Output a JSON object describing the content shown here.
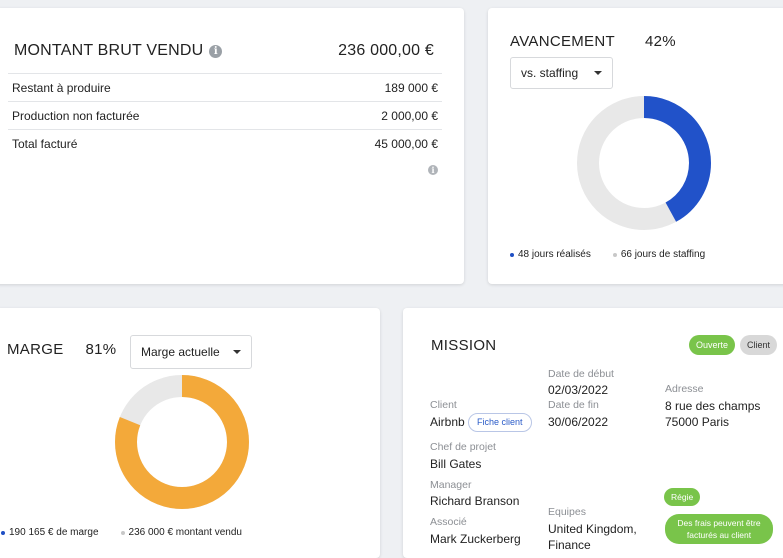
{
  "montant": {
    "title": "MONTANT BRUT VENDU",
    "total": "236 000,00 €",
    "rows": [
      {
        "label": "Restant à produire",
        "value": "189 000 €"
      },
      {
        "label": "Production non facturée",
        "value": "2 000,00 €"
      },
      {
        "label": "Total facturé",
        "value": "45 000,00 €"
      }
    ]
  },
  "avancement": {
    "title": "AVANCEMENT",
    "percent": "42%",
    "select_value": "vs. staffing",
    "legend": [
      {
        "label": "48 jours réalisés",
        "color": "#1f4fc4"
      },
      {
        "label": "66 jours de staffing",
        "color": "#c8c8c8"
      }
    ],
    "progress": 0.42,
    "colors": {
      "fill": "#2152c9",
      "track": "#e8e8e8"
    }
  },
  "marge": {
    "title": "MARGE",
    "percent": "81%",
    "select_value": "Marge actuelle",
    "legend": [
      {
        "label": "190 165 € de marge",
        "color": "#1f4fc4"
      },
      {
        "label": "236 000 € montant vendu",
        "color": "#c8c8c8"
      }
    ],
    "progress": 0.81,
    "colors": {
      "fill": "#f3a93a",
      "track": "#e8e8e8"
    }
  },
  "mission": {
    "title": "MISSION",
    "badge_status": "Ouverte",
    "badge_type": "Client",
    "client_label": "Client",
    "client_value": "Airbnb",
    "client_button": "Fiche client",
    "start_label": "Date de début",
    "start_value": "02/03/2022",
    "end_label": "Date de fin",
    "end_value": "30/06/2022",
    "address_label": "Adresse",
    "address_line1": "8 rue des champs",
    "address_line2": "75000  Paris",
    "chef_label": "Chef de projet",
    "chef_value": "Bill Gates",
    "manager_label": "Manager",
    "manager_value": "Richard Branson",
    "associe_label": "Associé",
    "associe_value": "Mark Zuckerberg",
    "equipes_label": "Equipes",
    "equipes_value": "United Kingdom,",
    "equipes_value2": "Finance",
    "regie_badge": "Régie",
    "frais_badge_line1": "Des frais peuvent être",
    "frais_badge_line2": "facturés au client"
  }
}
